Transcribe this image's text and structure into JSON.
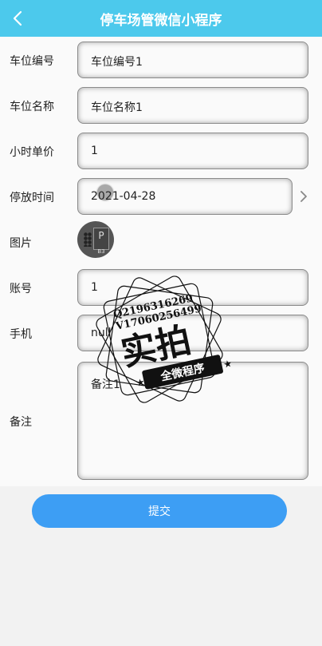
{
  "header": {
    "title": "停车场管微信小程序",
    "back_icon": "chevron-left-icon"
  },
  "form": {
    "space_no": {
      "label": "车位编号",
      "value": "车位编号1"
    },
    "space_name": {
      "label": "车位名称",
      "value": "车位名称1"
    },
    "hourly_price": {
      "label": "小时单价",
      "value": "1"
    },
    "parking_time": {
      "label": "停放时间",
      "value": "2021-04-28"
    },
    "image": {
      "label": "图片",
      "thumb_text": "P",
      "thumb_sub": "B3"
    },
    "account": {
      "label": "账号",
      "value": "1"
    },
    "phone": {
      "label": "手机",
      "value": "null"
    },
    "remarks": {
      "label": "备注",
      "value": "备注1"
    }
  },
  "submit_label": "提交",
  "watermark": {
    "contact1": "Q2196316269",
    "contact2": "V17060256499",
    "main": "实拍",
    "sub": "全微程序"
  },
  "colors": {
    "header_bg": "#4cc9ec",
    "button_bg": "#3d9ef4"
  }
}
